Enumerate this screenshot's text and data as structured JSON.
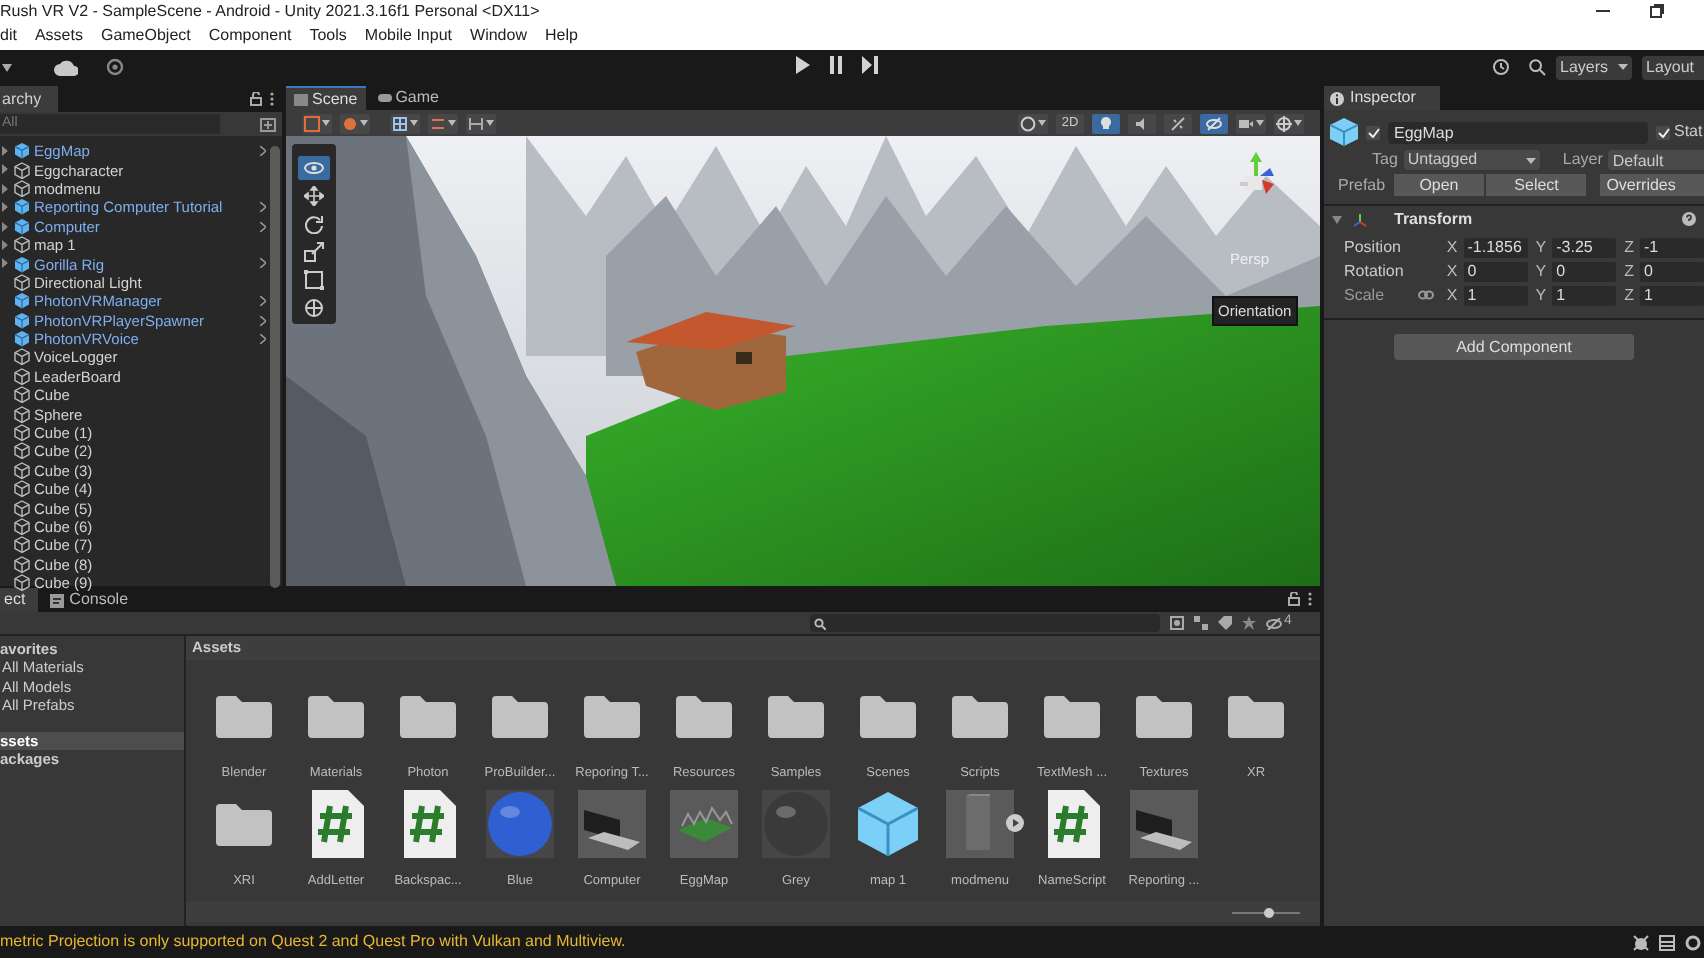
{
  "window": {
    "title": "Rush VR V2 - SampleScene - Android - Unity 2021.3.16f1 Personal <DX11>"
  },
  "menu": [
    "dit",
    "Assets",
    "GameObject",
    "Component",
    "Tools",
    "Mobile Input",
    "Window",
    "Help"
  ],
  "toolbar": {
    "layers": "Layers",
    "layout": "Layout"
  },
  "hierarchy": {
    "tab": "archy",
    "search": {
      "placeholder": "All"
    },
    "items": [
      {
        "label": "EggMap",
        "kind": "prefab",
        "has_children": true
      },
      {
        "label": "Eggcharacter",
        "kind": "object",
        "has_children": true
      },
      {
        "label": "modmenu",
        "kind": "object",
        "has_children": true
      },
      {
        "label": "Reporting Computer Tutorial",
        "kind": "prefab",
        "has_children": true
      },
      {
        "label": "Computer",
        "kind": "prefab",
        "has_children": true
      },
      {
        "label": "map 1",
        "kind": "object",
        "has_children": true
      },
      {
        "label": "Gorilla Rig",
        "kind": "prefab",
        "has_children": true
      },
      {
        "label": "Directional Light",
        "kind": "object",
        "has_children": false
      },
      {
        "label": "PhotonVRManager",
        "kind": "prefab",
        "has_children": false
      },
      {
        "label": "PhotonVRPlayerSpawner",
        "kind": "prefab",
        "has_children": false
      },
      {
        "label": "PhotonVRVoice",
        "kind": "prefab",
        "has_children": false
      },
      {
        "label": "VoiceLogger",
        "kind": "object",
        "has_children": false
      },
      {
        "label": "LeaderBoard",
        "kind": "object",
        "has_children": false
      },
      {
        "label": "Cube",
        "kind": "object",
        "has_children": false
      },
      {
        "label": "Sphere",
        "kind": "object",
        "has_children": false
      },
      {
        "label": "Cube (1)",
        "kind": "object",
        "has_children": false
      },
      {
        "label": "Cube (2)",
        "kind": "object",
        "has_children": false
      },
      {
        "label": "Cube (3)",
        "kind": "object",
        "has_children": false
      },
      {
        "label": "Cube (4)",
        "kind": "object",
        "has_children": false
      },
      {
        "label": "Cube (5)",
        "kind": "object",
        "has_children": false
      },
      {
        "label": "Cube (6)",
        "kind": "object",
        "has_children": false
      },
      {
        "label": "Cube (7)",
        "kind": "object",
        "has_children": false
      },
      {
        "label": "Cube (8)",
        "kind": "object",
        "has_children": false
      },
      {
        "label": "Cube (9)",
        "kind": "object",
        "has_children": false
      }
    ]
  },
  "scene": {
    "tabs": [
      {
        "label": "Scene",
        "selected": true
      },
      {
        "label": "Game",
        "selected": false
      }
    ],
    "toggles": [
      {
        "kind": "dimension",
        "label": "2D",
        "on": false
      },
      {
        "kind": "lighting",
        "on": true
      },
      {
        "kind": "audio",
        "on": false
      },
      {
        "kind": "effects",
        "on": false
      },
      {
        "kind": "visibility",
        "on": true
      }
    ],
    "tools": [
      {
        "kind": "view",
        "selected": true
      },
      {
        "kind": "move",
        "selected": false
      },
      {
        "kind": "rotate",
        "selected": false
      },
      {
        "kind": "scale",
        "selected": false
      },
      {
        "kind": "rect",
        "selected": false
      },
      {
        "kind": "transform",
        "selected": false
      }
    ],
    "gizmo_label": "Persp",
    "tooltip": "Orientation"
  },
  "inspector": {
    "tab": "Inspector",
    "object": {
      "name": "EggMap",
      "active": true,
      "static_label": "Stat",
      "static": true
    },
    "tag_label": "Tag",
    "tag": "Untagged",
    "layer_label": "Layer",
    "layer": "Default",
    "prefab_label": "Prefab",
    "prefab_buttons": [
      "Open",
      "Select",
      "Overrides"
    ],
    "transform": {
      "title": "Transform",
      "rows": [
        {
          "label": "Position",
          "values": [
            {
              "axis": "X",
              "value": "-1.1856"
            },
            {
              "axis": "Y",
              "value": "-3.25"
            },
            {
              "axis": "Z",
              "value": "-1"
            }
          ]
        },
        {
          "label": "Rotation",
          "values": [
            {
              "axis": "X",
              "value": "0"
            },
            {
              "axis": "Y",
              "value": "0"
            },
            {
              "axis": "Z",
              "value": "0"
            }
          ]
        },
        {
          "label": "Scale",
          "values": [
            {
              "axis": "X",
              "value": "1"
            },
            {
              "axis": "Y",
              "value": "1"
            },
            {
              "axis": "Z",
              "value": "1"
            }
          ]
        }
      ]
    },
    "add_component": "Add Component"
  },
  "project": {
    "tabs": [
      {
        "label": "ect",
        "selected": true
      },
      {
        "label": "Console",
        "selected": false
      }
    ],
    "hidden_count": "4",
    "zoom": {
      "level": 0.55
    },
    "sidebar": [
      {
        "label": "avorites",
        "kind": "header",
        "selected": false
      },
      {
        "label": "All Materials",
        "kind": "item",
        "selected": false
      },
      {
        "label": "All Models",
        "kind": "item",
        "selected": false
      },
      {
        "label": "All Prefabs",
        "kind": "item",
        "selected": false
      },
      {
        "label": "ssets",
        "kind": "header",
        "selected": true
      },
      {
        "label": "ackages",
        "kind": "header",
        "selected": false
      }
    ],
    "breadcrumb": "Assets",
    "assets": [
      {
        "label": "Blender",
        "kind": "folder"
      },
      {
        "label": "Materials",
        "kind": "folder"
      },
      {
        "label": "Photon",
        "kind": "folder"
      },
      {
        "label": "ProBuilder...",
        "kind": "folder"
      },
      {
        "label": "Reporing T...",
        "kind": "folder"
      },
      {
        "label": "Resources",
        "kind": "folder"
      },
      {
        "label": "Samples",
        "kind": "folder"
      },
      {
        "label": "Scenes",
        "kind": "folder"
      },
      {
        "label": "Scripts",
        "kind": "folder"
      },
      {
        "label": "TextMesh ...",
        "kind": "folder"
      },
      {
        "label": "Textures",
        "kind": "folder"
      },
      {
        "label": "XR",
        "kind": "folder"
      },
      {
        "label": "XRI",
        "kind": "folder"
      },
      {
        "label": "AddLetter",
        "kind": "script"
      },
      {
        "label": "Backspac...",
        "kind": "script"
      },
      {
        "label": "Blue",
        "kind": "material",
        "color": "#2f5fd0"
      },
      {
        "label": "Computer",
        "kind": "computer"
      },
      {
        "label": "EggMap",
        "kind": "map"
      },
      {
        "label": "Grey",
        "kind": "material",
        "color": "#3a3a3a"
      },
      {
        "label": "map 1",
        "kind": "cube"
      },
      {
        "label": "modmenu",
        "kind": "model"
      },
      {
        "label": "NameScript",
        "kind": "script"
      },
      {
        "label": "Reporting ...",
        "kind": "computer"
      }
    ]
  },
  "status": {
    "message": "metric Projection is only supported on Quest 2 and Quest Pro with Vulkan and Multiview."
  }
}
